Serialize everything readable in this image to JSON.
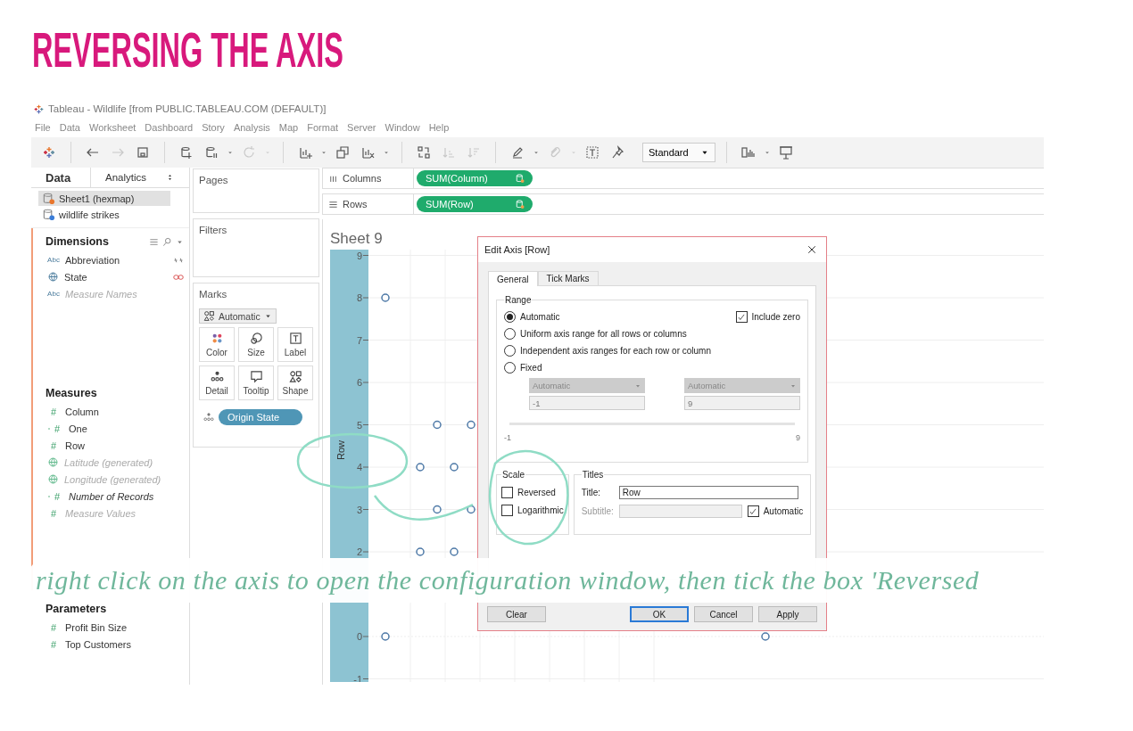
{
  "heading": "REVERSING THE AXIS",
  "window": {
    "title": "Tableau - Wildlife [from PUBLIC.TABLEAU.COM (DEFAULT)]"
  },
  "menu": [
    "File",
    "Data",
    "Worksheet",
    "Dashboard",
    "Story",
    "Analysis",
    "Map",
    "Format",
    "Server",
    "Window",
    "Help"
  ],
  "toolbar": [
    {
      "kind": "logo",
      "menu": false
    },
    {
      "kind": "separator"
    },
    {
      "kind": "back",
      "disabled": false,
      "menu": false
    },
    {
      "kind": "forward",
      "disabled": true,
      "menu": false
    },
    {
      "kind": "save",
      "disabled": false,
      "menu": false
    },
    {
      "kind": "separator"
    },
    {
      "kind": "new-source",
      "disabled": false,
      "menu": false
    },
    {
      "kind": "pause",
      "disabled": false,
      "menu": true
    },
    {
      "kind": "refresh",
      "disabled": true,
      "menu": true
    },
    {
      "kind": "separator"
    },
    {
      "kind": "new-sheet",
      "disabled": false,
      "menu": true
    },
    {
      "kind": "duplicate",
      "disabled": false,
      "menu": false
    },
    {
      "kind": "clear",
      "disabled": false,
      "menu": true
    },
    {
      "kind": "separator"
    },
    {
      "kind": "swap",
      "disabled": false,
      "menu": false
    },
    {
      "kind": "sort-asc",
      "disabled": true,
      "menu": false
    },
    {
      "kind": "sort-desc",
      "disabled": true,
      "menu": false
    },
    {
      "kind": "separator"
    },
    {
      "kind": "pen",
      "disabled": false,
      "menu": true
    },
    {
      "kind": "clip",
      "disabled": true,
      "menu": true
    },
    {
      "kind": "textbox",
      "disabled": false,
      "menu": false
    },
    {
      "kind": "pin",
      "disabled": false,
      "menu": false
    },
    {
      "kind": "fit",
      "value": "Standard"
    },
    {
      "kind": "separator"
    },
    {
      "kind": "showme",
      "disabled": false,
      "menu": true
    },
    {
      "kind": "present",
      "disabled": false,
      "menu": false
    }
  ],
  "data_pane": {
    "tabs": [
      {
        "label": "Data",
        "selected": true
      },
      {
        "label": "Analytics",
        "selected": false
      }
    ],
    "sources": [
      {
        "label": "Sheet1 (hexmap)",
        "selected": true
      },
      {
        "label": "wildlife strikes",
        "selected": false
      }
    ],
    "sections": [
      {
        "title": "Dimensions",
        "tools": true,
        "highlighted": true,
        "fields": [
          {
            "kind": "string",
            "glyph": "Abc",
            "label": "Abbreviation",
            "calculated": false,
            "disabled": false,
            "linked": true,
            "primary_link": false
          },
          {
            "kind": "geo",
            "label": "State",
            "calculated": false,
            "disabled": false,
            "linked": true,
            "primary_link": true
          },
          {
            "kind": "string",
            "glyph": "Abc",
            "label": "Measure Names",
            "calculated": true,
            "disabled": true,
            "linked": false
          }
        ]
      },
      {
        "title": "Measures",
        "tools": false,
        "highlighted": true,
        "fields": [
          {
            "kind": "number",
            "glyph": "#",
            "label": "Column",
            "calculated": false,
            "disabled": false,
            "linked": false
          },
          {
            "kind": "calc-number",
            "glyph": "#",
            "label": "One",
            "calculated": false,
            "disabled": false,
            "linked": false
          },
          {
            "kind": "number",
            "glyph": "#",
            "label": "Row",
            "calculated": false,
            "disabled": false,
            "linked": false
          },
          {
            "kind": "geo",
            "label": "Latitude (generated)",
            "calculated": true,
            "disabled": true,
            "linked": false
          },
          {
            "kind": "geo",
            "label": "Longitude (generated)",
            "calculated": true,
            "disabled": true,
            "linked": false
          },
          {
            "kind": "calc-number",
            "glyph": "#",
            "label": "Number of Records",
            "calculated": true,
            "disabled": false,
            "linked": false
          },
          {
            "kind": "number",
            "glyph": "#",
            "label": "Measure Values",
            "calculated": true,
            "disabled": true,
            "linked": false
          }
        ]
      },
      {
        "title": "Parameters",
        "tools": false,
        "highlighted": false,
        "fields": [
          {
            "kind": "number",
            "glyph": "#",
            "label": "Profit Bin Size",
            "calculated": false,
            "disabled": false,
            "linked": false
          },
          {
            "kind": "number",
            "glyph": "#",
            "label": "Top Customers",
            "calculated": false,
            "disabled": false,
            "linked": false
          }
        ]
      }
    ]
  },
  "cards": {
    "pages": "Pages",
    "filters": "Filters",
    "marks": {
      "title": "Marks",
      "mark_type": "Automatic",
      "buttons": [
        {
          "kind": "color",
          "label": "Color"
        },
        {
          "kind": "size",
          "label": "Size"
        },
        {
          "kind": "label",
          "label": "Label"
        },
        {
          "kind": "detail",
          "label": "Detail"
        },
        {
          "kind": "tooltip",
          "label": "Tooltip"
        },
        {
          "kind": "shape",
          "label": "Shape"
        }
      ],
      "pills": [
        {
          "kind": "detail",
          "label": "Origin State"
        }
      ]
    }
  },
  "shelves": [
    {
      "kind": "columns",
      "label": "Columns",
      "pill": "SUM(Column)"
    },
    {
      "kind": "rows",
      "label": "Rows",
      "pill": "SUM(Row)"
    }
  ],
  "sheet": {
    "title": "Sheet 9",
    "chart": {
      "axis_title": "Row",
      "upper_tick_labels": [
        "9",
        "8",
        "7",
        "6",
        "5",
        "4",
        "3",
        "2"
      ],
      "lower_tick_labels": [
        "0",
        "-1"
      ]
    }
  },
  "dialog": {
    "title": "Edit Axis [Row]",
    "tabs": [
      {
        "label": "General",
        "selected": true
      },
      {
        "label": "Tick Marks",
        "selected": false
      }
    ],
    "range": {
      "title": "Range",
      "options": [
        {
          "label": "Automatic",
          "selected": true
        },
        {
          "label": "Uniform axis range for all rows or columns",
          "selected": false
        },
        {
          "label": "Independent axis ranges for each row or column",
          "selected": false
        },
        {
          "label": "Fixed",
          "selected": false
        }
      ],
      "include_zero": {
        "label": "Include zero",
        "checked": true
      },
      "min_dropdown": {
        "value": "Automatic",
        "disabled": true
      },
      "max_dropdown": {
        "value": "Automatic",
        "disabled": true
      },
      "min_value": {
        "value": "-1",
        "disabled": true
      },
      "max_value": {
        "value": "9",
        "disabled": true
      },
      "slider_min_label": "-1",
      "slider_max_label": "9"
    },
    "scale": {
      "title": "Scale",
      "options": [
        {
          "label": "Reversed",
          "checked": false
        },
        {
          "label": "Logarithmic",
          "checked": false
        }
      ]
    },
    "titles": {
      "title": "Titles",
      "title_label": "Title:",
      "title_value": "Row",
      "subtitle_label": "Subtitle:",
      "subtitle_disabled": true,
      "automatic": {
        "label": "Automatic",
        "checked": true
      }
    },
    "buttons": [
      {
        "label": "Clear",
        "default": false
      },
      {
        "label": "OK",
        "default": true
      },
      {
        "label": "Cancel",
        "default": false
      },
      {
        "label": "Apply",
        "default": false
      }
    ]
  },
  "caption": "right click on the axis to open the configuration window, then tick the box 'Reversed"
}
